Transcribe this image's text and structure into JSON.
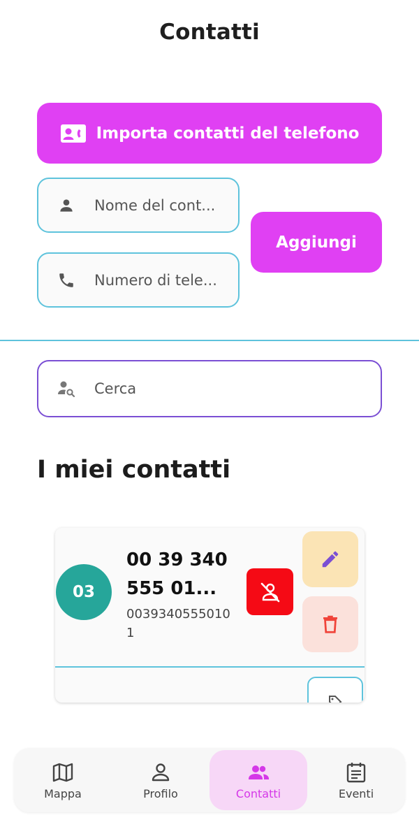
{
  "header": {
    "title": "Contatti"
  },
  "import_button": {
    "label": "Importa contatti del telefono",
    "icon": "contact-card-icon"
  },
  "form": {
    "name_placeholder": "Nome del cont...",
    "phone_placeholder": "Numero di tele...",
    "add_label": "Aggiungi"
  },
  "search": {
    "placeholder": "Cerca"
  },
  "section": {
    "title": "I miei contatti"
  },
  "contacts": [
    {
      "initials": "03",
      "name": "00 39 340 555 01...",
      "number": "00393405550101"
    }
  ],
  "nav": {
    "items": [
      {
        "label": "Mappa",
        "icon": "map-icon"
      },
      {
        "label": "Profilo",
        "icon": "person-icon"
      },
      {
        "label": "Contatti",
        "icon": "group-icon"
      },
      {
        "label": "Eventi",
        "icon": "calendar-icon"
      }
    ],
    "active": "Contatti"
  },
  "colors": {
    "primary": "#e040f3",
    "field_border": "#5ec3dc",
    "search_border": "#7b4fd4",
    "avatar": "#26a69a",
    "danger": "#f50a15",
    "edit_bg": "#fbe4b5",
    "delete_bg": "#fbe1db"
  }
}
